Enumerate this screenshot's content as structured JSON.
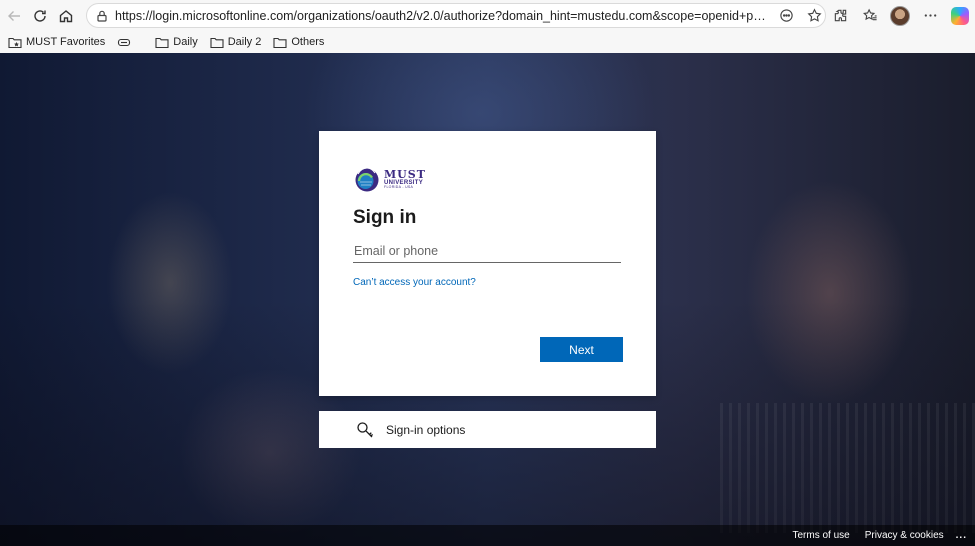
{
  "browser": {
    "url": "https://login.microsoftonline.com/organizations/oauth2/v2.0/authorize?domain_hint=mustedu.com&scope=openid+profile+email&resp...",
    "favorites": [
      {
        "label": "MUST Favorites",
        "icon": "favorites-folder-icon"
      },
      {
        "label": "",
        "icon": "collections-icon"
      },
      {
        "label": "Daily",
        "icon": "folder-icon"
      },
      {
        "label": "Daily 2",
        "icon": "folder-icon"
      },
      {
        "label": "Others",
        "icon": "folder-icon"
      }
    ]
  },
  "logo": {
    "name": "MUST",
    "subtitle": "UNIVERSITY",
    "location": "FLORIDA - USA"
  },
  "signin": {
    "title": "Sign in",
    "email_placeholder": "Email or phone",
    "email_value": "",
    "cant_access_link": "Can’t access your account?",
    "next_button": "Next"
  },
  "options": {
    "label": "Sign-in options"
  },
  "footer": {
    "terms": "Terms of use",
    "privacy": "Privacy & cookies",
    "more": "..."
  },
  "colors": {
    "primary": "#0067b8",
    "brand_purple": "#3b2a82"
  }
}
